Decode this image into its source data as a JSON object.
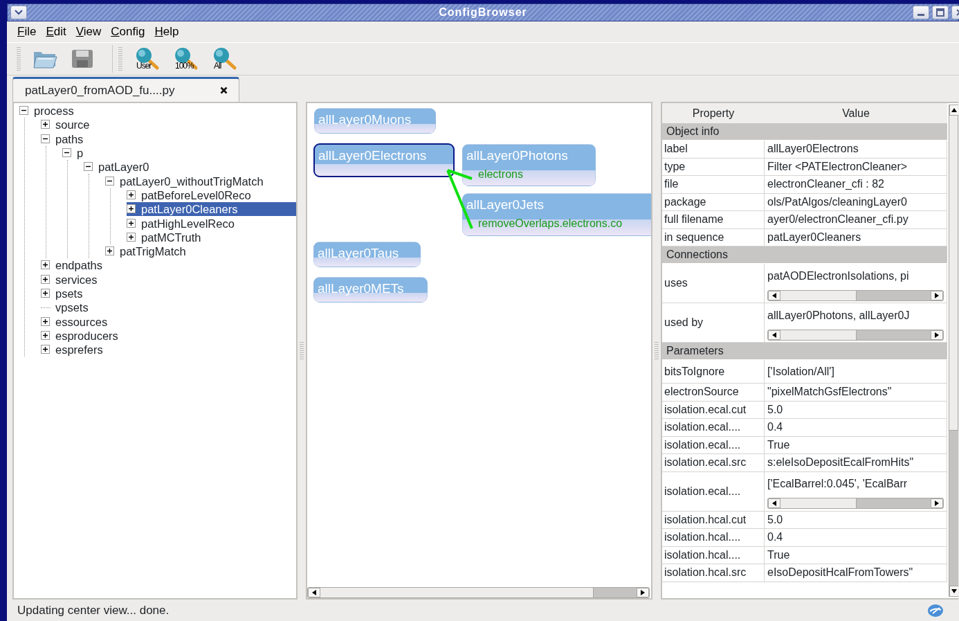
{
  "window": {
    "title": "ConfigBrowser"
  },
  "menu": [
    {
      "label": "File"
    },
    {
      "label": "Edit"
    },
    {
      "label": "View"
    },
    {
      "label": "Config"
    },
    {
      "label": "Help"
    }
  ],
  "toolbar": [
    {
      "kind": "open"
    },
    {
      "kind": "save"
    },
    {
      "kind": "search",
      "label": "User"
    },
    {
      "kind": "search",
      "label": "100%"
    },
    {
      "kind": "search",
      "label": "All"
    }
  ],
  "tabs": [
    {
      "label": "patLayer0_fromAOD_fu....py",
      "selected": true
    }
  ],
  "tree": [
    {
      "label": "process",
      "kind": "branch",
      "expanded": true,
      "selected": false,
      "children": [
        {
          "label": "source",
          "kind": "branch",
          "expanded": false,
          "selected": false
        },
        {
          "label": "paths",
          "kind": "branch",
          "expanded": true,
          "selected": false,
          "children": [
            {
              "label": "p",
              "kind": "branch",
              "expanded": true,
              "selected": false,
              "children": [
                {
                  "label": "patLayer0",
                  "kind": "branch",
                  "expanded": true,
                  "selected": false,
                  "children": [
                    {
                      "label": "patLayer0_withoutTrigMatch",
                      "kind": "branch",
                      "expanded": true,
                      "selected": false,
                      "children": [
                        {
                          "label": "patBeforeLevel0Reco",
                          "kind": "branch",
                          "expanded": false,
                          "selected": false
                        },
                        {
                          "label": "patLayer0Cleaners",
                          "kind": "branch",
                          "expanded": false,
                          "selected": true
                        },
                        {
                          "label": "patHighLevelReco",
                          "kind": "branch",
                          "expanded": false,
                          "selected": false
                        },
                        {
                          "label": "patMCTruth",
                          "kind": "branch",
                          "expanded": false,
                          "selected": false
                        }
                      ]
                    },
                    {
                      "label": "patTrigMatch",
                      "kind": "branch",
                      "expanded": false,
                      "selected": false
                    }
                  ]
                }
              ]
            }
          ]
        },
        {
          "label": "endpaths",
          "kind": "branch",
          "expanded": false,
          "selected": false
        },
        {
          "label": "services",
          "kind": "branch",
          "expanded": false,
          "selected": false
        },
        {
          "label": "psets",
          "kind": "branch",
          "expanded": false,
          "selected": false
        },
        {
          "label": "vpsets",
          "kind": "leaf",
          "selected": false
        },
        {
          "label": "essources",
          "kind": "branch",
          "expanded": false,
          "selected": false
        },
        {
          "label": "esproducers",
          "kind": "branch",
          "expanded": false,
          "selected": false
        },
        {
          "label": "esprefers",
          "kind": "branch",
          "expanded": false,
          "selected": false
        }
      ]
    }
  ],
  "canvas": {
    "nodes": [
      {
        "label": "allLayer0Muons",
        "selected": false
      },
      {
        "label": "allLayer0Electrons",
        "selected": true
      },
      {
        "label": "allLayer0Photons",
        "selected": false,
        "ports": [
          {
            "label": "electrons",
            "connected": true
          }
        ]
      },
      {
        "label": "allLayer0Jets",
        "selected": false,
        "ports": [
          {
            "label": "removeOverlaps.electrons.co",
            "connected": true
          }
        ]
      },
      {
        "label": "allLayer0Taus",
        "selected": false
      },
      {
        "label": "allLayer0METs",
        "selected": false
      }
    ]
  },
  "properties": {
    "columns": [
      "Property",
      "Value"
    ],
    "sections": [
      {
        "title": "Object info",
        "rows": [
          {
            "name": "label",
            "value": "allLayer0Electrons",
            "kind": "text"
          },
          {
            "name": "type",
            "value": "Filter <PATElectronCleaner>",
            "kind": "text"
          },
          {
            "name": "file",
            "value": "electronCleaner_cfi : 82",
            "kind": "text"
          },
          {
            "name": "package",
            "value": "ols/PatAlgos/cleaningLayer0",
            "kind": "text"
          },
          {
            "name": "full filename",
            "value": "ayer0/electronCleaner_cfi.py",
            "kind": "text"
          },
          {
            "name": "in sequence",
            "value": "patLayer0Cleaners",
            "kind": "text"
          }
        ]
      },
      {
        "title": "Connections",
        "rows": [
          {
            "name": "uses",
            "value": "patAODElectronIsolations, pi",
            "kind": "scroll"
          },
          {
            "name": "used by",
            "value": "allLayer0Photons, allLayer0J",
            "kind": "scroll"
          }
        ]
      },
      {
        "title": "Parameters",
        "rows": [
          {
            "name": "bitsToIgnore",
            "value": "['Isolation/All']",
            "kind": "tall"
          },
          {
            "name": "electronSource",
            "value": "\"pixelMatchGsfElectrons\"",
            "kind": "text"
          },
          {
            "name": "isolation.ecal.cut",
            "value": "5.0",
            "kind": "text"
          },
          {
            "name": "isolation.ecal....",
            "value": "0.4",
            "kind": "text"
          },
          {
            "name": "isolation.ecal....",
            "value": "True",
            "kind": "text"
          },
          {
            "name": "isolation.ecal.src",
            "value": "s:eleIsoDepositEcalFromHits\"",
            "kind": "text"
          },
          {
            "name": "isolation.ecal....",
            "value": "['EcalBarrel:0.045', 'EcalBarr",
            "kind": "scroll"
          },
          {
            "name": "isolation.hcal.cut",
            "value": "5.0",
            "kind": "text"
          },
          {
            "name": "isolation.hcal....",
            "value": "0.4",
            "kind": "text"
          },
          {
            "name": "isolation.hcal....",
            "value": "True",
            "kind": "text"
          },
          {
            "name": "isolation.hcal.src",
            "value": "eIsoDepositHcalFromTowers\"",
            "kind": "text"
          }
        ]
      }
    ]
  },
  "status_bar": {
    "text": "Updating center view... done."
  }
}
